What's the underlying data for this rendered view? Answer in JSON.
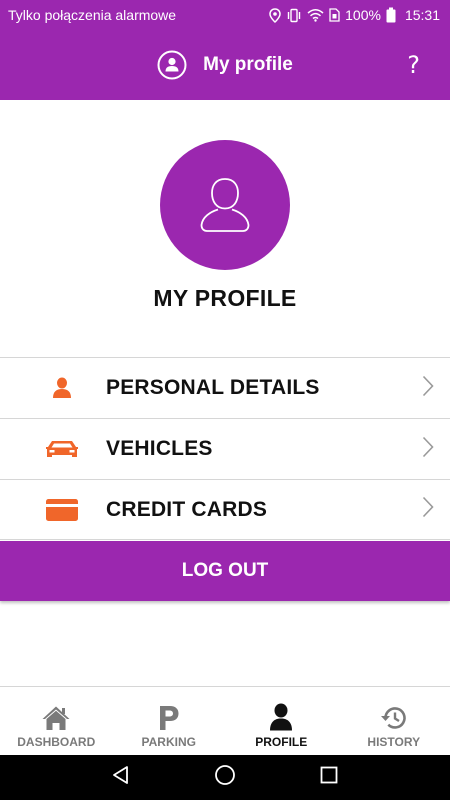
{
  "status_bar": {
    "carrier": "Tylko połączenia alarmowe",
    "battery": "100%",
    "time": "15:31"
  },
  "app_bar": {
    "title": "My profile",
    "help": "?"
  },
  "profile": {
    "heading": "MY PROFILE"
  },
  "menu": [
    {
      "label": "PERSONAL DETAILS",
      "icon": "person-icon"
    },
    {
      "label": "VEHICLES",
      "icon": "car-icon"
    },
    {
      "label": "CREDIT CARDS",
      "icon": "credit-card-icon"
    }
  ],
  "logout": {
    "label": "LOG OUT"
  },
  "bottom_nav": [
    {
      "label": "DASHBOARD",
      "icon": "home-icon",
      "active": false
    },
    {
      "label": "PARKING",
      "icon": "parking-icon",
      "active": false
    },
    {
      "label": "PROFILE",
      "icon": "person-icon",
      "active": true
    },
    {
      "label": "HISTORY",
      "icon": "history-icon",
      "active": false
    }
  ],
  "colors": {
    "brand": "#9b27af",
    "accent_orange": "#f0662a",
    "nav_inactive": "#7a7a7a"
  }
}
